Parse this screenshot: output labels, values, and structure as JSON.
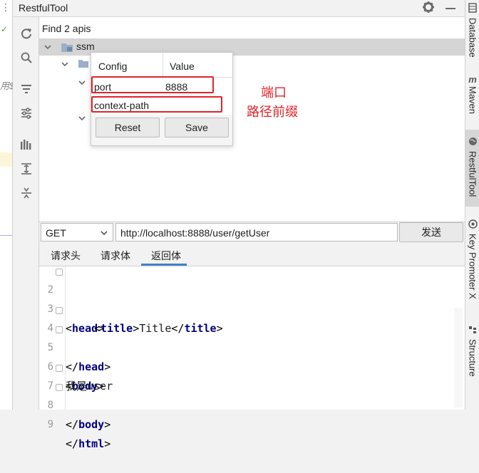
{
  "window": {
    "title": "RestfulTool"
  },
  "left_slice": {
    "check_glyph": "✓",
    "fragment_text": "用$"
  },
  "tree": {
    "summary": "Find 2 apis",
    "root_label": "ssm"
  },
  "config_popup": {
    "col_config": "Config",
    "col_value": "Value",
    "rows": [
      {
        "key": "port",
        "value": "8888"
      },
      {
        "key": "context-path",
        "value": ""
      }
    ],
    "reset_label": "Reset",
    "save_label": "Save"
  },
  "annotations": {
    "port_note": "端口",
    "context_path_note": "路径前缀",
    "color": "#e0242b"
  },
  "request": {
    "method": "GET",
    "url": "http://localhost:8888/user/getUser",
    "send_label": "发送"
  },
  "tabs": [
    {
      "label": "请求头",
      "active": false
    },
    {
      "label": "请求体",
      "active": false
    },
    {
      "label": "返回体",
      "active": true
    }
  ],
  "code": {
    "line_numbers": [
      "2",
      "3",
      "4",
      "5",
      "6",
      "7",
      "8",
      "9"
    ],
    "text_3": "Title",
    "text_6": "我是user",
    "tags": {
      "head": "head",
      "title": "title",
      "body": "body",
      "html": "html"
    }
  },
  "right_sidebar": {
    "tabs": [
      {
        "label": "Database",
        "icon": "database-icon"
      },
      {
        "label": "Maven",
        "icon": "maven-icon"
      },
      {
        "label": "RestfulTool",
        "icon": "globe-icon",
        "active": true
      },
      {
        "label": "Key Promoter X",
        "icon": "key-promoter-icon"
      },
      {
        "label": "Structure",
        "icon": "structure-icon"
      }
    ]
  },
  "colors": {
    "accent_tab": "#4083c9",
    "tag_blue": "#000080",
    "highlight_red": "#e0242b"
  }
}
